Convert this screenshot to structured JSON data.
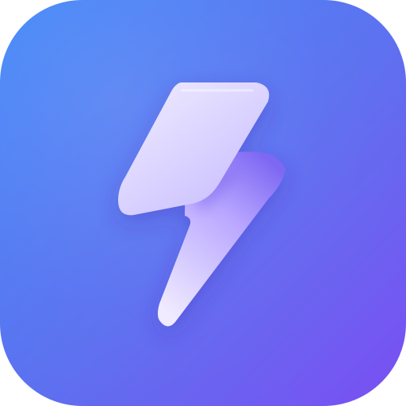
{
  "icon": {
    "name": "lightning-bolt-app-icon",
    "glyph": "lightning-bolt-icon",
    "colors": {
      "background_start": "#3f86f7",
      "background_mid": "#5a6ff0",
      "background_end": "#7b4ff2",
      "bolt_top": "#ddd6ff",
      "bolt_bottom": "#b9a7ff",
      "bolt_shadow": "#6c52ea",
      "bolt_highlight": "#ffffff"
    }
  }
}
